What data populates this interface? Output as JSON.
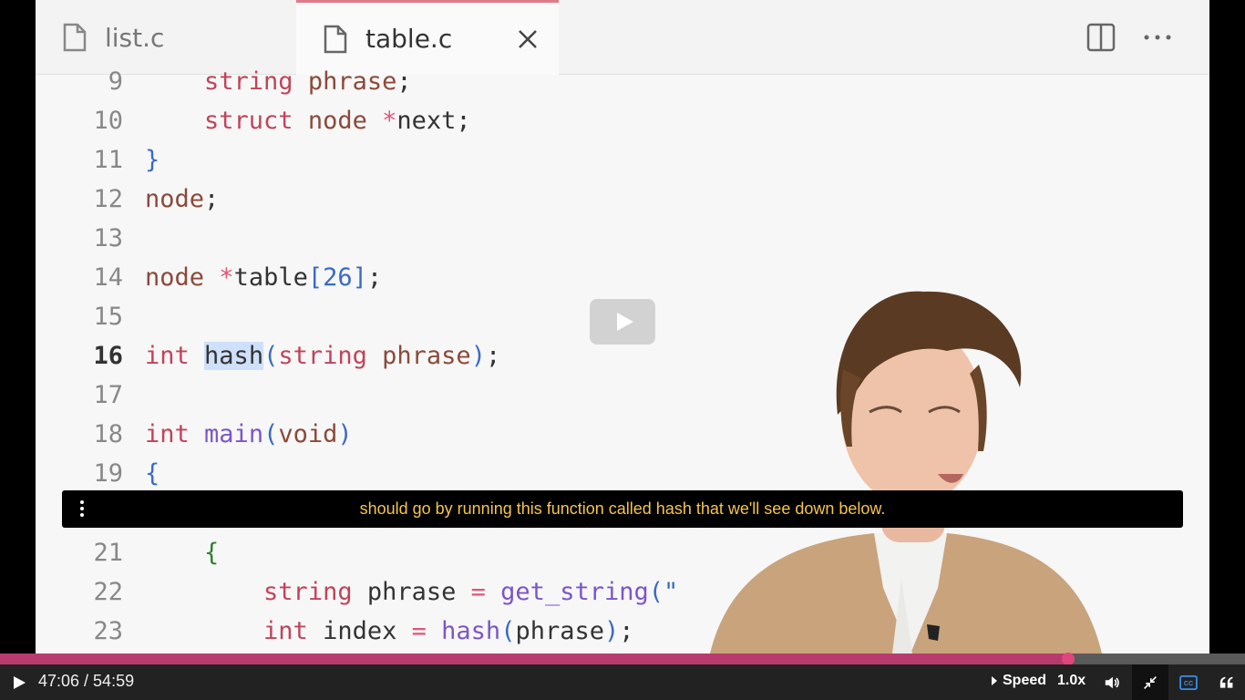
{
  "editor": {
    "tabs": [
      {
        "label": "list.c",
        "active": false
      },
      {
        "label": "table.c",
        "active": true
      }
    ],
    "icons": {
      "file": "file-icon",
      "close": "close-icon",
      "split": "split-editor-icon",
      "more": "more-icon"
    },
    "lines": [
      {
        "num": "9",
        "tokens": [
          [
            "pad",
            "    "
          ],
          [
            "tp",
            "string"
          ],
          [
            "t",
            " "
          ],
          [
            "var",
            "phrase"
          ],
          [
            "t",
            ";"
          ]
        ]
      },
      {
        "num": "10",
        "tokens": [
          [
            "pad",
            "    "
          ],
          [
            "kw",
            "struct"
          ],
          [
            "t",
            " "
          ],
          [
            "var",
            "node"
          ],
          [
            "t",
            " "
          ],
          [
            "op",
            "*"
          ],
          [
            "t",
            "next;"
          ]
        ]
      },
      {
        "num": "11",
        "tokens": [
          [
            "pn",
            "}"
          ]
        ]
      },
      {
        "num": "12",
        "tokens": [
          [
            "var",
            "node"
          ],
          [
            "t",
            ";"
          ]
        ]
      },
      {
        "num": "13",
        "tokens": []
      },
      {
        "num": "14",
        "tokens": [
          [
            "var",
            "node"
          ],
          [
            "t",
            " "
          ],
          [
            "op",
            "*"
          ],
          [
            "t",
            "table"
          ],
          [
            "pn",
            "["
          ],
          [
            "num",
            "26"
          ],
          [
            "pn",
            "]"
          ],
          [
            "t",
            ";"
          ]
        ]
      },
      {
        "num": "15",
        "tokens": []
      },
      {
        "num": "16",
        "tokens": [
          [
            "kw",
            "int"
          ],
          [
            "t",
            " "
          ],
          [
            "hl",
            "hash"
          ],
          [
            "pn",
            "("
          ],
          [
            "tp",
            "string"
          ],
          [
            "t",
            " "
          ],
          [
            "var",
            "phrase"
          ],
          [
            "pn",
            ")"
          ],
          [
            "t",
            ";"
          ]
        ],
        "active": true
      },
      {
        "num": "17",
        "tokens": []
      },
      {
        "num": "18",
        "tokens": [
          [
            "kw",
            "int"
          ],
          [
            "t",
            " "
          ],
          [
            "fn",
            "main"
          ],
          [
            "pn",
            "("
          ],
          [
            "var",
            "void"
          ],
          [
            "pn",
            ")"
          ]
        ]
      },
      {
        "num": "19",
        "tokens": [
          [
            "pn",
            "{"
          ]
        ]
      },
      {
        "num": "21",
        "tokens": [
          [
            "pad",
            "    "
          ],
          [
            "str",
            "{"
          ]
        ]
      },
      {
        "num": "22",
        "tokens": [
          [
            "pad",
            "        "
          ],
          [
            "tp",
            "string"
          ],
          [
            "t",
            " phrase "
          ],
          [
            "op",
            "="
          ],
          [
            "t",
            " "
          ],
          [
            "fn",
            "get_string"
          ],
          [
            "pn",
            "(\""
          ]
        ]
      },
      {
        "num": "23",
        "tokens": [
          [
            "pad",
            "        "
          ],
          [
            "kw",
            "int"
          ],
          [
            "t",
            " index "
          ],
          [
            "op",
            "="
          ],
          [
            "t",
            " "
          ],
          [
            "fn",
            "hash"
          ],
          [
            "pn",
            "("
          ],
          [
            "t",
            "phrase"
          ],
          [
            "pn",
            ")"
          ],
          [
            "t",
            ";"
          ]
        ]
      }
    ]
  },
  "caption": {
    "text": "should go by running this function called hash that we'll see down below.",
    "color": "#f5c54a"
  },
  "player": {
    "time": "47:06 / 54:59",
    "progress": 0.858,
    "speed_label": "Speed",
    "speed_value": "1.0x",
    "accent": "#b83b6d",
    "icons": [
      "play-icon",
      "volume-icon",
      "exit-fullscreen-icon",
      "closed-captions-icon",
      "quote-icon"
    ]
  }
}
